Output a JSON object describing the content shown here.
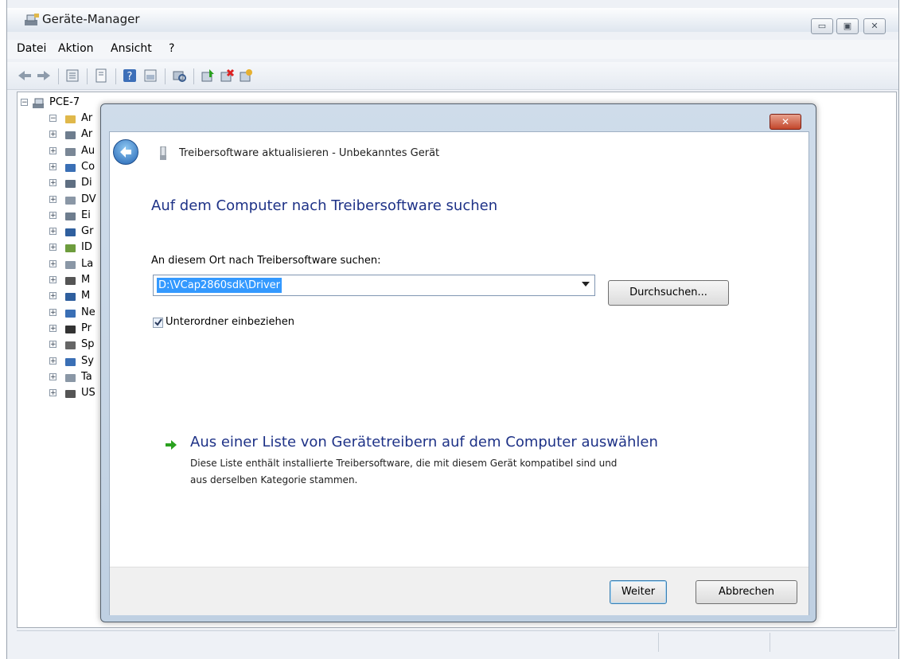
{
  "window": {
    "title": "Geräte-Manager",
    "controls": [
      "minimize",
      "maximize",
      "close"
    ]
  },
  "menu": [
    "Datei",
    "Aktion",
    "Ansicht",
    "?"
  ],
  "toolbar_icons": [
    "back-arrow-icon",
    "forward-arrow-icon",
    "show-hide-tree-icon",
    "properties-icon",
    "help-icon",
    "view-icon",
    "scan-hardware-icon",
    "update-driver-icon",
    "uninstall-icon",
    "disable-icon"
  ],
  "tree": {
    "root": "PCE-7",
    "items": [
      {
        "label": "Ar",
        "icon": "unknown-device-icon"
      },
      {
        "label": "Ar",
        "icon": "network-adapter-icon"
      },
      {
        "label": "Au",
        "icon": "audio-icon"
      },
      {
        "label": "Co",
        "icon": "computer-icon"
      },
      {
        "label": "Di",
        "icon": "disk-drive-icon"
      },
      {
        "label": "DV",
        "icon": "dvd-drive-icon"
      },
      {
        "label": "Ei",
        "icon": "input-device-icon"
      },
      {
        "label": "Gr",
        "icon": "display-adapter-icon"
      },
      {
        "label": "ID",
        "icon": "ide-controller-icon"
      },
      {
        "label": "La",
        "icon": "drive-icon"
      },
      {
        "label": "M",
        "icon": "mouse-icon"
      },
      {
        "label": "M",
        "icon": "monitor-icon"
      },
      {
        "label": "Ne",
        "icon": "network-icon"
      },
      {
        "label": "Pr",
        "icon": "processor-icon"
      },
      {
        "label": "Sp",
        "icon": "storage-icon"
      },
      {
        "label": "Sy",
        "icon": "system-device-icon"
      },
      {
        "label": "Ta",
        "icon": "keyboard-icon"
      },
      {
        "label": "US",
        "icon": "usb-icon"
      }
    ]
  },
  "dialog": {
    "title": "Treibersoftware aktualisieren - Unbekanntes Gerät",
    "heading": "Auf dem Computer nach Treibersoftware suchen",
    "field_label": "An diesem Ort nach Treibersoftware suchen:",
    "path_value": "D:\\VCap2860sdk\\Driver",
    "browse_label": "Durchsuchen...",
    "include_subfolders_label": "Unterordner einbeziehen",
    "include_subfolders_checked": true,
    "link_title": "Aus einer Liste von Gerätetreibern auf dem Computer auswählen",
    "link_desc_line1": "Diese Liste enthält installierte Treibersoftware, die mit diesem Gerät kompatibel sind und",
    "link_desc_line2": "aus derselben Kategorie stammen.",
    "next_label": "Weiter",
    "cancel_label": "Abbrechen"
  },
  "colors": {
    "heading_blue": "#1e3287",
    "selection_blue": "#3399ff",
    "link_arrow_green": "#2aa11f",
    "close_red": "#c3462b"
  }
}
